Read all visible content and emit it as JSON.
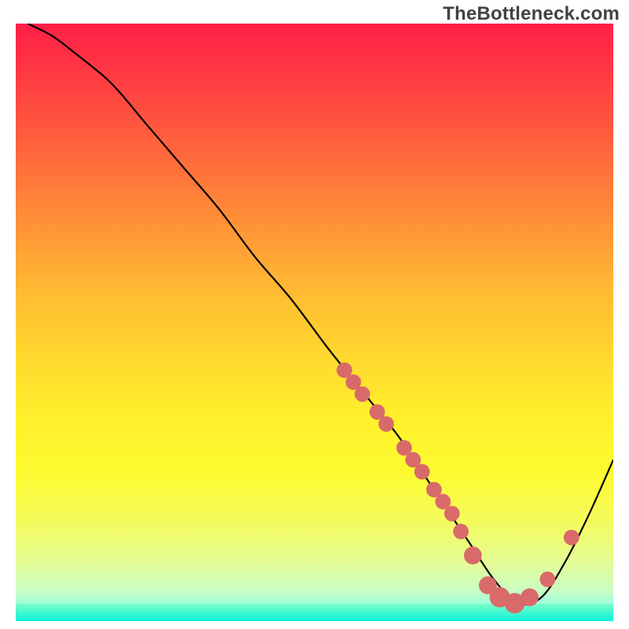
{
  "watermark": "TheBottleneck.com",
  "chart_data": {
    "type": "line",
    "title": "",
    "xlabel": "",
    "ylabel": "",
    "xlim": [
      0,
      100
    ],
    "ylim": [
      0,
      100
    ],
    "grid": false,
    "legend": false,
    "notes": "Axes are unlabeled in the source image; values are estimated on a 0–100 scale from pixel positions. Curve resembles a bottleneck/mismatch plot with minimum near x≈82.",
    "series": [
      {
        "name": "curve",
        "color": "#000000",
        "x": [
          2,
          6,
          10,
          16,
          22,
          28,
          34,
          40,
          46,
          52,
          56,
          60,
          64,
          68,
          72,
          76,
          80,
          84,
          88,
          92,
          96,
          100
        ],
        "y": [
          100,
          98,
          95,
          90,
          83,
          76,
          69,
          61,
          54,
          46,
          41,
          36,
          31,
          25,
          19,
          13,
          7,
          3,
          4,
          10,
          18,
          27
        ]
      }
    ],
    "markers": [
      {
        "x": 55,
        "y": 42,
        "r": 1.3
      },
      {
        "x": 56.5,
        "y": 40,
        "r": 1.3
      },
      {
        "x": 58,
        "y": 38,
        "r": 1.3
      },
      {
        "x": 60.5,
        "y": 35,
        "r": 1.3
      },
      {
        "x": 62,
        "y": 33,
        "r": 1.3
      },
      {
        "x": 65,
        "y": 29,
        "r": 1.3
      },
      {
        "x": 66.5,
        "y": 27,
        "r": 1.3
      },
      {
        "x": 68,
        "y": 25,
        "r": 1.3
      },
      {
        "x": 70,
        "y": 22,
        "r": 1.3
      },
      {
        "x": 71.5,
        "y": 20,
        "r": 1.3
      },
      {
        "x": 73,
        "y": 18,
        "r": 1.3
      },
      {
        "x": 74.5,
        "y": 15,
        "r": 1.3
      },
      {
        "x": 76.5,
        "y": 11,
        "r": 1.5
      },
      {
        "x": 79,
        "y": 6,
        "r": 1.5
      },
      {
        "x": 81,
        "y": 4,
        "r": 1.7
      },
      {
        "x": 83.5,
        "y": 3,
        "r": 1.7
      },
      {
        "x": 86,
        "y": 4,
        "r": 1.5
      },
      {
        "x": 89,
        "y": 7,
        "r": 1.3
      },
      {
        "x": 93,
        "y": 14,
        "r": 1.3
      }
    ],
    "marker_color": "#d96a6a",
    "background_gradient": {
      "top": "#ff1f47",
      "mid": "#ffd92e",
      "bottom": "#13eedb"
    }
  }
}
